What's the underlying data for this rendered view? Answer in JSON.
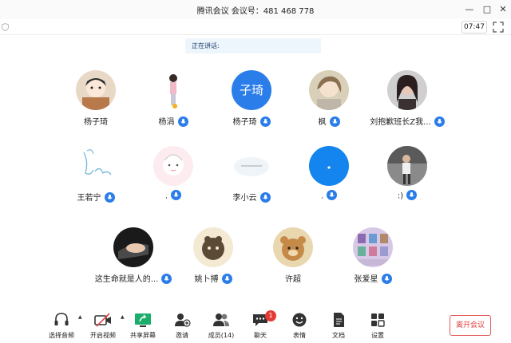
{
  "window": {
    "title": "腾讯会议 会议号：481 468 778"
  },
  "session": {
    "timer": "07:47"
  },
  "speaking": {
    "label": "正在讲话:"
  },
  "participants": [
    {
      "name": "杨子琦",
      "mic": false
    },
    {
      "name": "杨涓",
      "mic": true
    },
    {
      "name": "杨子琦",
      "mic": true,
      "avatar_text": "子琦"
    },
    {
      "name": "枫",
      "mic": true
    },
    {
      "name": "刘抱歉班长Z我...",
      "mic": true
    },
    {
      "name": "王若宁",
      "mic": true
    },
    {
      "name": ".",
      "mic": true
    },
    {
      "name": "李小云",
      "mic": true
    },
    {
      "name": ".",
      "mic": true
    },
    {
      "name": ":)",
      "mic": true
    },
    {
      "name": "这生命就是人的...",
      "mic": true
    },
    {
      "name": "姚卜搏",
      "mic": true
    },
    {
      "name": "许超",
      "mic": false
    },
    {
      "name": "张爱星",
      "mic": true
    }
  ],
  "toolbar": {
    "audio": "选择音频",
    "video": "开启视频",
    "share": "共享屏幕",
    "invite": "邀请",
    "members": "成员(14)",
    "chat": "聊天",
    "chat_badge": "1",
    "reactions": "表情",
    "docs": "文档",
    "settings": "设置",
    "leave": "离开会议"
  },
  "colors": {
    "accent": "#2b7de9",
    "danger": "#e04040",
    "share_green": "#1aad6b"
  }
}
